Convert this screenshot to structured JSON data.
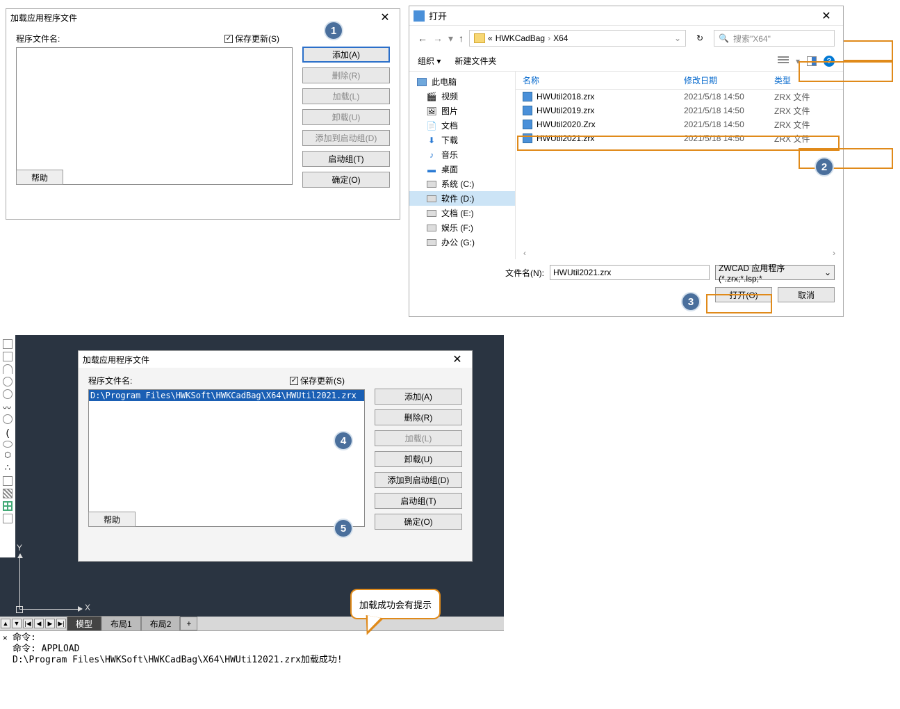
{
  "dialog1": {
    "title": "加载应用程序文件",
    "programFilesLabel": "程序文件名:",
    "saveUpdatesLabel": "保存更新(S)",
    "buttons": {
      "add": "添加(A)",
      "delete": "删除(R)",
      "load": "加载(L)",
      "unload": "卸载(U)",
      "addToStartup": "添加到启动组(D)",
      "startupGroup": "启动组(T)",
      "ok": "确定(O)"
    },
    "help": "帮助"
  },
  "dialog2": {
    "title": "打开",
    "path": {
      "prefix": "«",
      "seg1": "HWKCadBag",
      "seg2": "X64"
    },
    "searchPlaceholder": "搜索\"X64\"",
    "organize": "组织",
    "newFolder": "新建文件夹",
    "sidebar": {
      "thisPC": "此电脑",
      "video": "视频",
      "pictures": "图片",
      "documents": "文档",
      "downloads": "下载",
      "music": "音乐",
      "desktop": "桌面",
      "sysC": "系统 (C:)",
      "softD": "软件 (D:)",
      "docE": "文档 (E:)",
      "entF": "娱乐 (F:)",
      "offG": "办公 (G:)"
    },
    "columns": {
      "name": "名称",
      "date": "修改日期",
      "type": "类型"
    },
    "files": [
      {
        "name": "HWUtil2018.zrx",
        "date": "2021/5/18 14:50",
        "type": "ZRX 文件"
      },
      {
        "name": "HWUtil2019.zrx",
        "date": "2021/5/18 14:50",
        "type": "ZRX 文件"
      },
      {
        "name": "HWUtil2020.Zrx",
        "date": "2021/5/18 14:50",
        "type": "ZRX 文件"
      },
      {
        "name": "HWUtil2021.zrx",
        "date": "2021/5/18 14:50",
        "type": "ZRX 文件"
      }
    ],
    "filenameLabel": "文件名(N):",
    "filenameValue": "HWUtil2021.zrx",
    "filterLabel": "ZWCAD 应用程序 (*.zrx;*.lsp;*",
    "open": "打开(O)",
    "cancel": "取消"
  },
  "dialog3": {
    "title": "加载应用程序文件",
    "programFilesLabel": "程序文件名:",
    "saveUpdatesLabel": "保存更新(S)",
    "selectedFile": "D:\\Program Files\\HWKSoft\\HWKCadBag\\X64\\HWUtil2021.zrx",
    "buttons": {
      "add": "添加(A)",
      "delete": "删除(R)",
      "load": "加载(L)",
      "unload": "卸载(U)",
      "addToStartup": "添加到启动组(D)",
      "startupGroup": "启动组(T)",
      "ok": "确定(O)"
    },
    "help": "帮助"
  },
  "cad": {
    "tabs": {
      "model": "模型",
      "layout1": "布局1",
      "layout2": "布局2"
    },
    "axis": {
      "y": "Y",
      "x": "X"
    }
  },
  "cmdline": {
    "line1": "命令:",
    "line2": "命令: APPLOAD",
    "line3": "D:\\Program Files\\HWKSoft\\HWKCadBag\\X64\\HWUti12021.zrx加载成功!"
  },
  "callout": "加载成功会有提示",
  "badges": {
    "b1": "1",
    "b2": "2",
    "b3": "3",
    "b4": "4",
    "b5": "5"
  }
}
